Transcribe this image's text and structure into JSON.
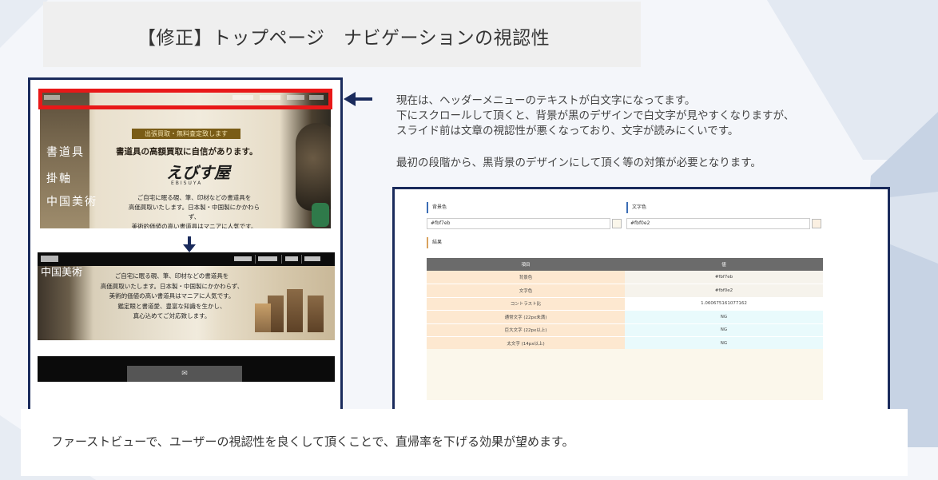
{
  "title": "【修正】トップページ　ナビゲーションの視認性",
  "colors": {
    "frame_border": "#1a2b5c",
    "highlight": "#e81818",
    "title_bg": "#efefef"
  },
  "before_screenshot": {
    "banner": "出張買取・無料査定致します",
    "tagline": "書道具の高額買取に自信があります。",
    "logo": "えびす屋",
    "logo_sub": "EBISUYA",
    "side_labels": [
      "書道具",
      "掛軸",
      "中国美術"
    ],
    "body_lines": [
      "ご自宅に眠る硯、筆、印材などの書道具を",
      "高価買取いたします。日本製・中国製にかかわらず、",
      "美術的価値の高い書道具はマニアに人気です。"
    ]
  },
  "after_screenshot": {
    "side_text": "中国美術",
    "body_lines": [
      "ご自宅に眠る硯、筆、印材などの書道具を",
      "高価買取いたします。日本製・中国製にかかわらず、",
      "美術的価値の高い書道具はマニアに人気です。",
      "鑑定眼と書道愛、豊富な知識を生かし、",
      "真心込めてご対応致します。"
    ],
    "mail_icon": "envelope-icon",
    "mail_glyph": "✉"
  },
  "description": {
    "lines": [
      "現在は、ヘッダーメニューのテキストが白文字になってます。",
      "下にスクロールして頂くと、背景が黒のデザインで白文字が見やすくなりますが、",
      "スライド前は文章の視認性が悪くなっており、文字が読みにくいです。"
    ],
    "second": "最初の段階から、黒背景のデザインにして頂く等の対策が必要となります。"
  },
  "contrast_checker": {
    "bg_label": "背景色",
    "bg_value": "#fbf7eb",
    "fg_label": "文字色",
    "fg_value": "#fbf0e2",
    "result_label": "結果",
    "table_headers": [
      "項目",
      "値"
    ],
    "rows": [
      {
        "key": "背景色",
        "value": "#fbf7eb"
      },
      {
        "key": "文字色",
        "value": "#fbf0e2"
      },
      {
        "key": "コントラスト比",
        "value": "1.060675161077162"
      },
      {
        "key": "通常文字 (22px未満)",
        "value": "NG"
      },
      {
        "key": "巨大文字 (22px以上)",
        "value": "NG"
      },
      {
        "key": "太文字 (14px以上)",
        "value": "NG"
      }
    ]
  },
  "conclusion": "ファーストビューで、ユーザーの視認性を良くして頂くことで、直帰率を下げる効果が望めます。"
}
